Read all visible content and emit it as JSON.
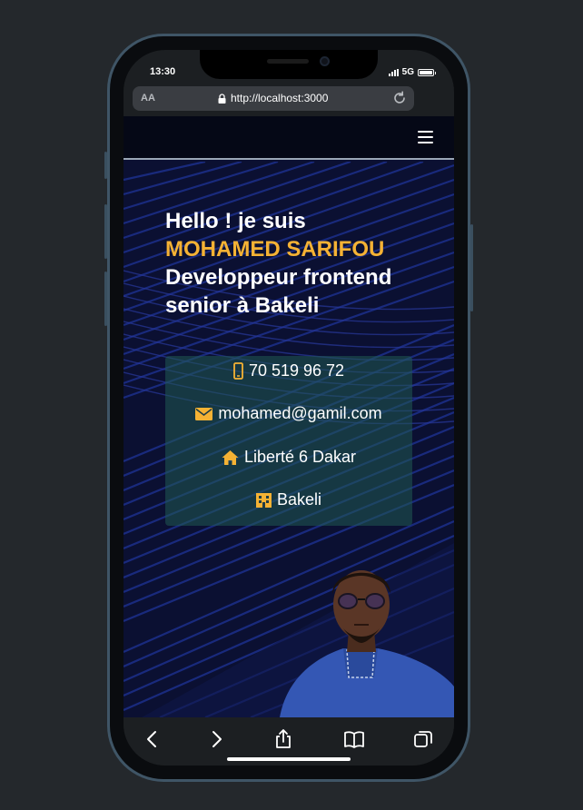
{
  "status_bar": {
    "time": "13:30",
    "network": "5G"
  },
  "browser": {
    "text_size_label": "AA",
    "url": "http://localhost:3000"
  },
  "hero": {
    "greeting": "Hello ! je suis",
    "name": "MOHAMED SARIFOU",
    "role_line1": "Developpeur frontend",
    "role_line2": "senior à Bakeli"
  },
  "contact": {
    "phone": "70 519 96 72",
    "email": "mohamed@gamil.com",
    "address": "Liberté 6 Dakar",
    "company": "Bakeli"
  },
  "colors": {
    "accent": "#f5b234",
    "background": "#0b1032",
    "card": "#205a52"
  },
  "icons": {
    "nav_menu": "hamburger-menu-icon",
    "phone": "mobile-phone-icon",
    "email": "envelope-icon",
    "address": "house-icon",
    "company": "building-icon",
    "toolbar": [
      "back-arrow-icon",
      "forward-arrow-icon",
      "share-icon",
      "bookmarks-icon",
      "tabs-icon"
    ]
  }
}
